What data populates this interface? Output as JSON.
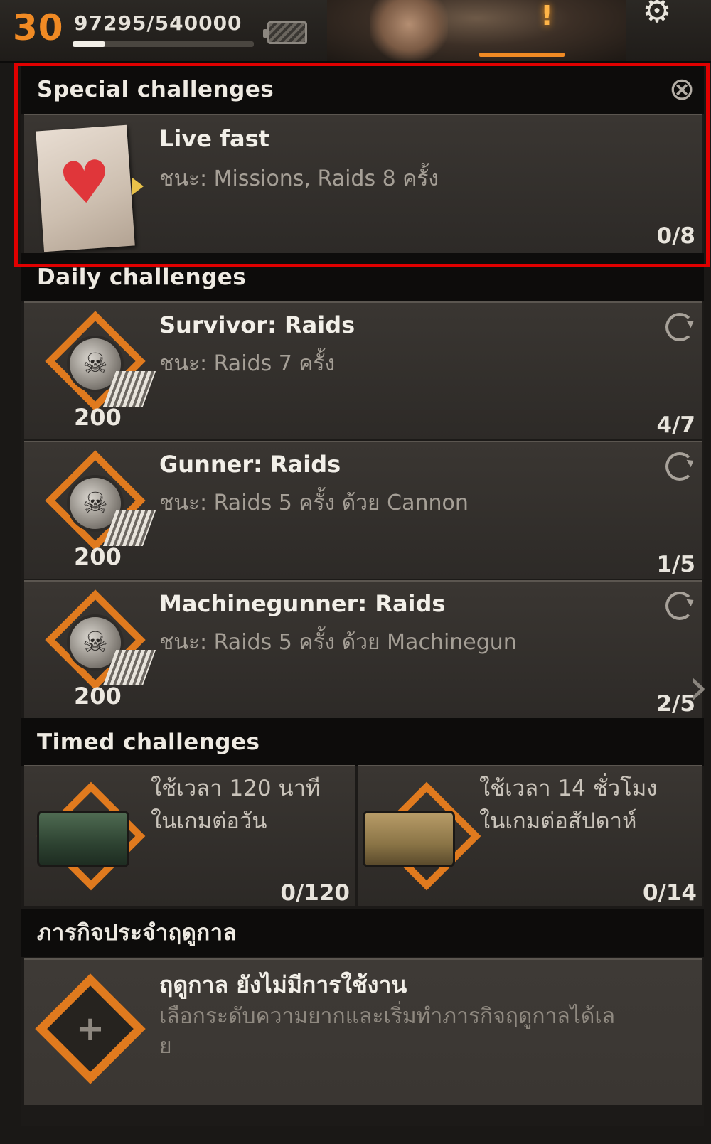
{
  "topbar": {
    "level": "30",
    "xp_text": "97295/540000",
    "xp_progress": 0.18,
    "icons": {
      "battery": "battery-icon",
      "alert": "alert-icon",
      "settings": "gear-icon"
    },
    "alert_glyph": "!",
    "gear_glyph": "⚙"
  },
  "special": {
    "header": "Special challenges",
    "close_glyph": "⊗",
    "title": "Live fast",
    "description": "ชนะ: Missions, Raids 8 ครั้ง",
    "progress": "0/8",
    "heart_glyph": "♥"
  },
  "daily": {
    "header": "Daily challenges",
    "items": [
      {
        "title": "Survivor: Raids",
        "description": "ชนะ: Raids 7 ครั้ง",
        "reward": "200",
        "progress": "4/7"
      },
      {
        "title": "Gunner: Raids",
        "description": "ชนะ: Raids 5 ครั้ง  ด้วย Cannon",
        "reward": "200",
        "progress": "1/5"
      },
      {
        "title": "Machinegunner: Raids",
        "description": "ชนะ: Raids 5 ครั้ง ด้วย Machinegun",
        "reward": "200",
        "progress": "2/5"
      }
    ],
    "skull_glyph": "☠"
  },
  "timed": {
    "header": "Timed challenges",
    "items": [
      {
        "line1": "ใช้เวลา 120 นาที",
        "line2": "ในเกมต่อวัน",
        "progress": "0/120"
      },
      {
        "line1": "ใช้เวลา 14 ชั่วโมง",
        "line2": "ในเกมต่อสัปดาห์",
        "progress": "0/14"
      }
    ]
  },
  "season": {
    "header": "ภารกิจประจำฤดูกาล",
    "title": "ฤดูกาล ยังไม่มีการใช้งาน",
    "description": "เลือกระดับความยากและเริ่มทำภารกิจฤดูกาลได้เล",
    "description_cont": "ย",
    "plus_glyph": "+"
  },
  "accent_colors": {
    "level": "#f08a24",
    "diamond": "#e07a1e",
    "highlight": "#e00000"
  },
  "next_arrow_glyph": "›"
}
